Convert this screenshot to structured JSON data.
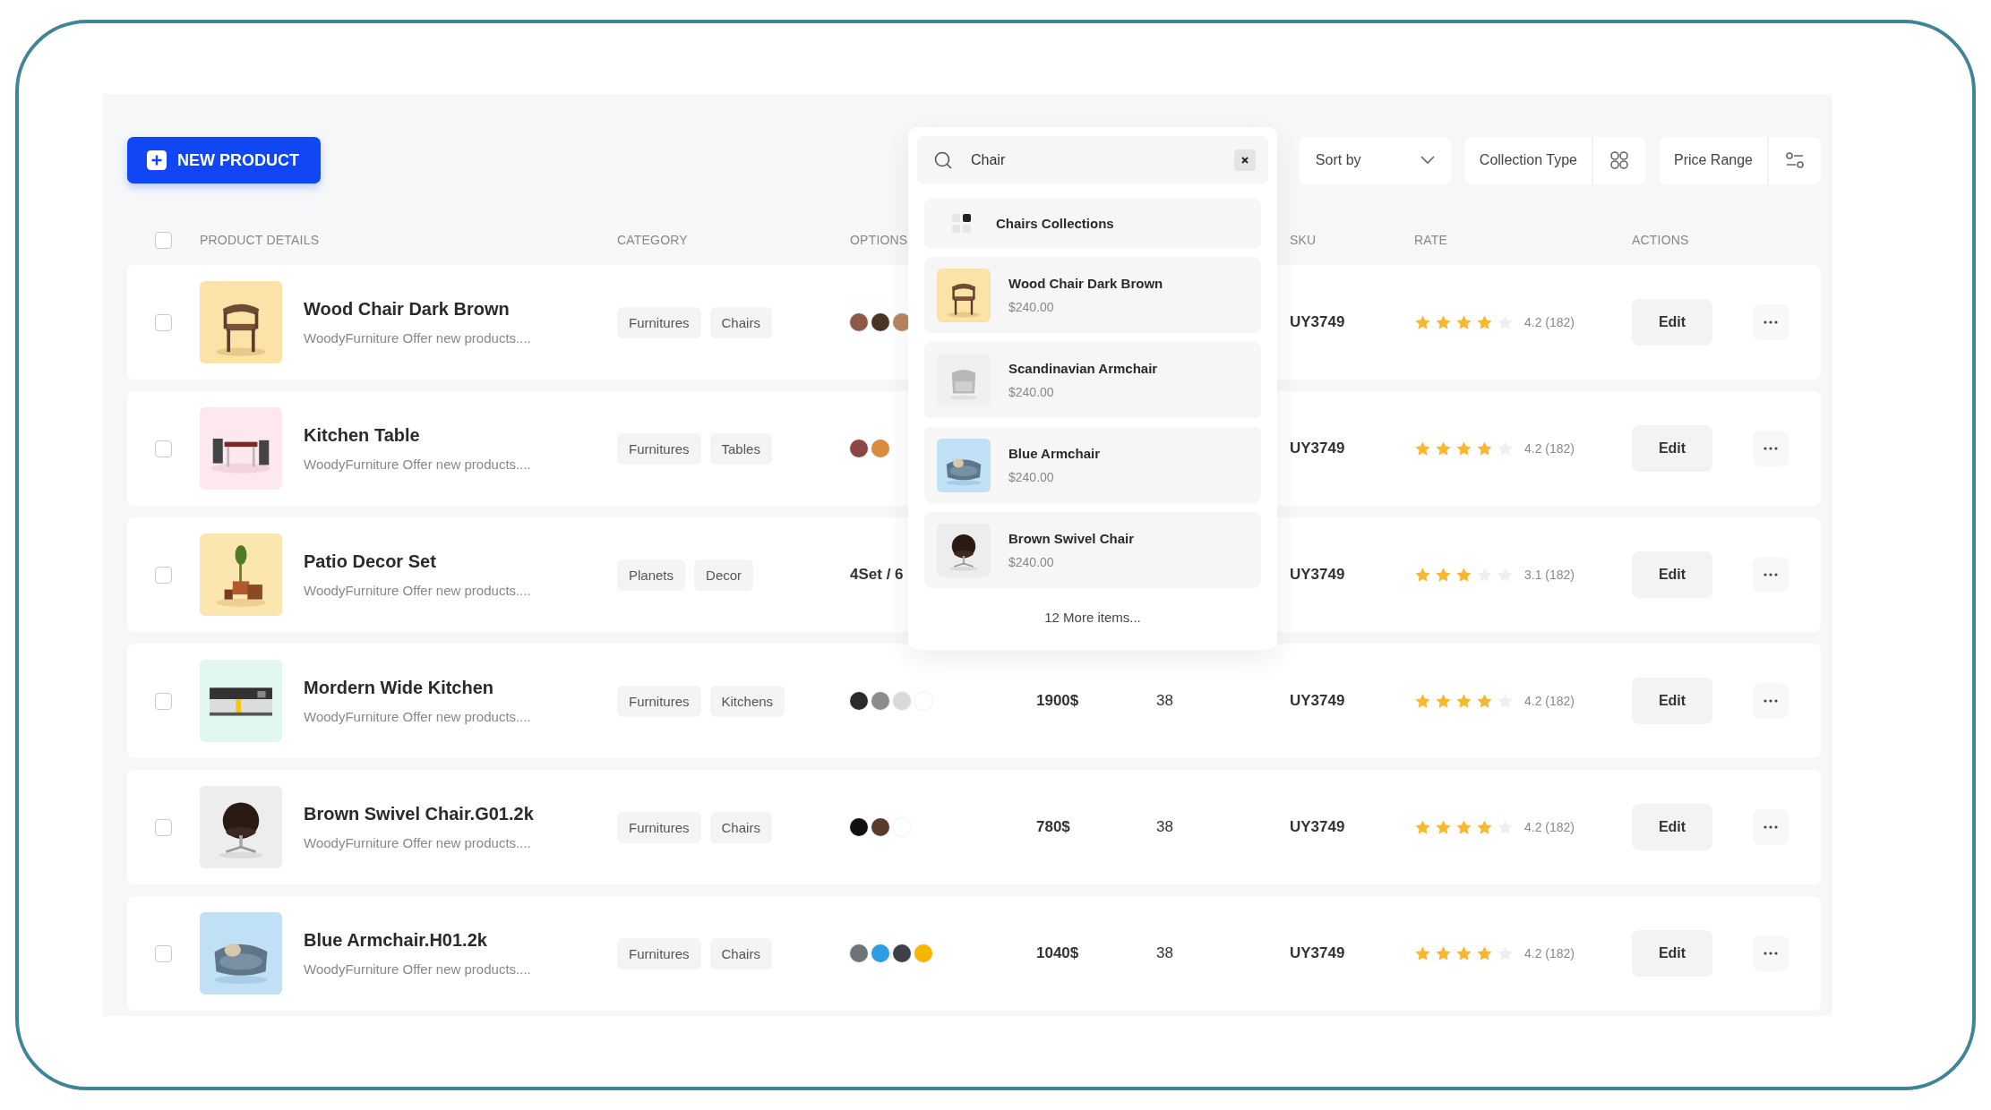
{
  "toolbar": {
    "new_button": "NEW PRODUCT",
    "sort": "Sort by",
    "collection": "Collection Type",
    "price_range": "Price Range"
  },
  "search": {
    "value": "Chair",
    "results": [
      {
        "kind": "collection",
        "title": "Chairs Collections"
      },
      {
        "kind": "product",
        "title": "Wood Chair Dark Brown",
        "price": "$240.00",
        "thumb": {
          "kind": "picture"
        }
      },
      {
        "kind": "product",
        "title": "Scandinavian Armchair",
        "price": "$240.00",
        "thumb": {
          "kind": "picture"
        }
      },
      {
        "kind": "product",
        "title": "Blue Armchair",
        "price": "$240.00",
        "thumb": {
          "kind": "picture"
        }
      },
      {
        "kind": "product",
        "title": "Brown Swivel Chair",
        "price": "$240.00",
        "thumb": {
          "kind": "picture"
        }
      }
    ],
    "more": "12 More items..."
  },
  "table": {
    "select_all": {
      "checked": false
    },
    "columns": [
      {
        "kind": "details",
        "label": "PRODUCT DETAILS"
      },
      {
        "kind": "category",
        "label": "CATEGORY"
      },
      {
        "kind": "options",
        "label": "OPTIONS"
      },
      {
        "kind": "sku",
        "label": "SKU"
      },
      {
        "kind": "rate",
        "label": "RATE"
      },
      {
        "kind": "actions",
        "label": "ACTIONS"
      }
    ],
    "rows": [
      {
        "checked": false,
        "thumb": {
          "kind": "picture"
        },
        "name": "Wood Chair Dark Brown",
        "description": "WoodyFurniture Offer new products....",
        "tags": [
          "Furnitures",
          "Chairs"
        ],
        "options": {
          "kind": "swatches",
          "swatches": [
            {
              "color": "#8a5a44"
            },
            {
              "color": "#4a3426"
            },
            {
              "color": "#b98560"
            }
          ]
        },
        "sku": "UY3749",
        "stars": 4,
        "rating": "4.2 (182)",
        "edit": "Edit"
      },
      {
        "checked": false,
        "thumb": {
          "kind": "picture"
        },
        "name": "Kitchen Table",
        "description": "WoodyFurniture Offer new products....",
        "tags": [
          "Furnitures",
          "Tables"
        ],
        "options": {
          "kind": "swatches",
          "swatches": [
            {
              "color": "#8e4545"
            },
            {
              "color": "#d98a3c"
            }
          ]
        },
        "sku": "UY3749",
        "stars": 4,
        "rating": "4.2 (182)",
        "edit": "Edit"
      },
      {
        "checked": false,
        "thumb": {
          "kind": "picture"
        },
        "name": "Patio Decor Set",
        "description": "WoodyFurniture Offer new products....",
        "tags": [
          "Planets",
          "Decor"
        ],
        "options": {
          "kind": "text",
          "text": "4Set / 6"
        },
        "sku": "UY3749",
        "stars": 3,
        "rating": "3.1 (182)",
        "edit": "Edit"
      },
      {
        "checked": false,
        "thumb": {
          "kind": "picture"
        },
        "name": "Mordern Wide Kitchen",
        "description": "WoodyFurniture Offer new products....",
        "tags": [
          "Furnitures",
          "Kitchens"
        ],
        "options": {
          "kind": "swatches",
          "swatches": [
            {
              "color": "#2b2b2b"
            },
            {
              "color": "#8c8c8c"
            },
            {
              "color": "#d9d9d9"
            },
            {
              "color": "#ffffff"
            }
          ]
        },
        "price": "1900$",
        "stock": "38",
        "sku": "UY3749",
        "stars": 4,
        "rating": "4.2 (182)",
        "edit": "Edit"
      },
      {
        "checked": false,
        "thumb": {
          "kind": "picture"
        },
        "name": "Brown Swivel Chair.G01.2k",
        "description": "WoodyFurniture Offer new products....",
        "tags": [
          "Furnitures",
          "Chairs"
        ],
        "options": {
          "kind": "swatches",
          "swatches": [
            {
              "color": "#111111"
            },
            {
              "color": "#5a3a2a"
            },
            {
              "color": "#ffffff"
            }
          ]
        },
        "price": "780$",
        "stock": "38",
        "sku": "UY3749",
        "stars": 4,
        "rating": "4.2 (182)",
        "edit": "Edit"
      },
      {
        "checked": false,
        "thumb": {
          "kind": "picture"
        },
        "name": "Blue Armchair.H01.2k",
        "description": "WoodyFurniture Offer new products....",
        "tags": [
          "Furnitures",
          "Chairs"
        ],
        "options": {
          "kind": "swatches",
          "swatches": [
            {
              "color": "#6f7479"
            },
            {
              "color": "#2f9be0"
            },
            {
              "color": "#3d4046"
            },
            {
              "color": "#f7b500"
            }
          ]
        },
        "price": "1040$",
        "stock": "38",
        "sku": "UY3749",
        "stars": 4,
        "rating": "4.2 (182)",
        "edit": "Edit"
      }
    ]
  }
}
